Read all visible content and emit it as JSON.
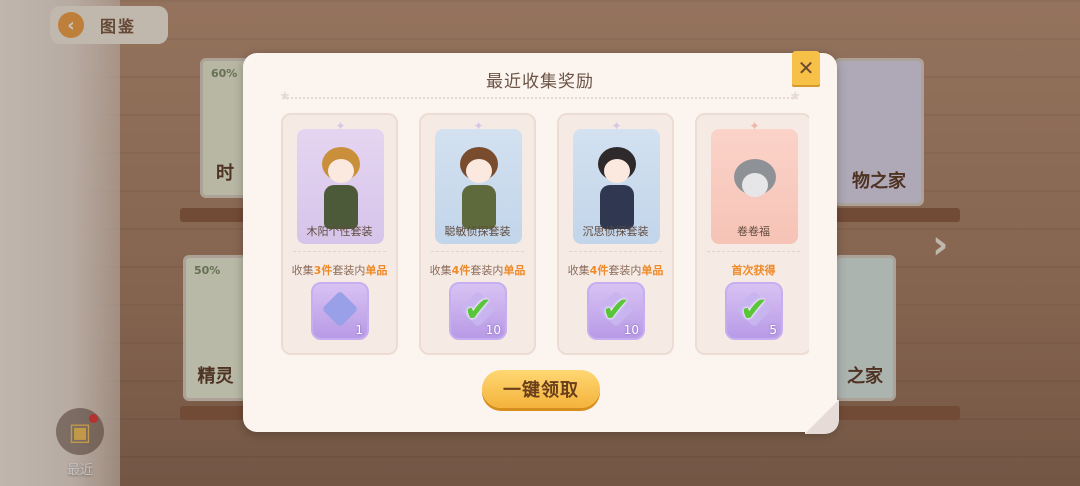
{
  "background": {
    "back_label": "图鉴",
    "recent_label": "最近",
    "books": [
      {
        "pct": "60%",
        "label": "时"
      },
      {
        "pct": "50%",
        "label": "精灵"
      },
      {
        "pct": "",
        "label": "物之家"
      },
      {
        "pct": "",
        "label": "之家"
      }
    ]
  },
  "modal": {
    "title": "最近收集奖励",
    "claim_label": "一键领取",
    "cards": [
      {
        "name": "木阳个性套装",
        "req_prefix": "收集",
        "req_count": "3件",
        "req_mid": "套装内",
        "req_suffix": "单品",
        "reward_count": "1",
        "claimed": false
      },
      {
        "name": "聪敏侦探套装",
        "req_prefix": "收集",
        "req_count": "4件",
        "req_mid": "套装内",
        "req_suffix": "单品",
        "reward_count": "10",
        "claimed": true
      },
      {
        "name": "沉思侦探套装",
        "req_prefix": "收集",
        "req_count": "4件",
        "req_mid": "套装内",
        "req_suffix": "单品",
        "reward_count": "10",
        "claimed": true
      },
      {
        "name": "卷卷福",
        "req_prefix": "",
        "req_count": "首次获得",
        "req_mid": "",
        "req_suffix": "",
        "reward_count": "5",
        "claimed": true
      }
    ]
  },
  "colors": {
    "accent": "#f4b33b",
    "highlight": "#ee8a2a",
    "check": "#5ac43a",
    "reward_bg": "#c7aef0"
  }
}
